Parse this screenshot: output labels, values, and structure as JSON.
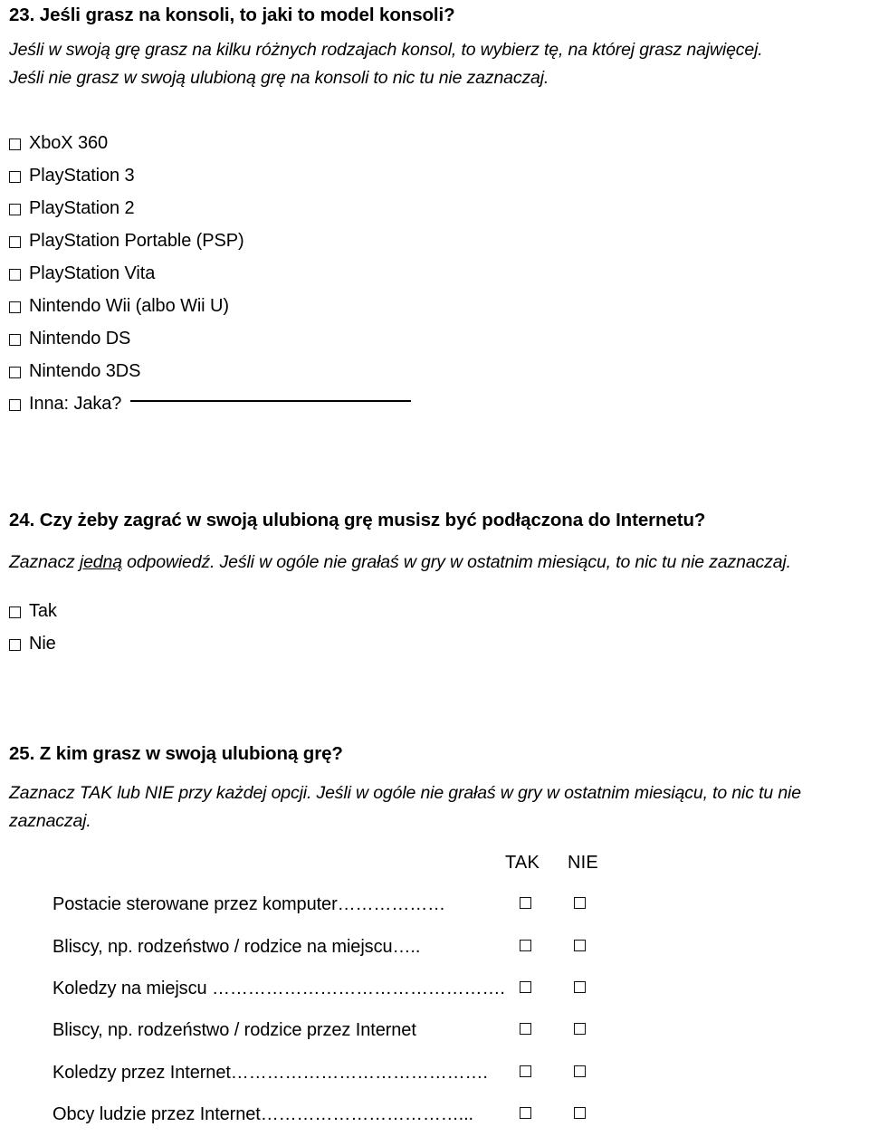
{
  "document": {
    "language": "pl",
    "background_color": "#ffffff",
    "text_color": "#000000"
  },
  "q23": {
    "heading": "23. Jeśli grasz na konsoli, to jaki to model konsoli?",
    "instruction_line1": "Jeśli w swoją grę grasz na kilku różnych rodzajach konsol, to wybierz tę, na której grasz najwięcej.",
    "instruction_line2": "Jeśli nie grasz w swoją ulubioną grę na konsoli to nic tu nie zaznaczaj.",
    "options": [
      {
        "label": "XboX 360"
      },
      {
        "label": "PlayStation 3"
      },
      {
        "label": "PlayStation 2"
      },
      {
        "label": "PlayStation Portable (PSP)"
      },
      {
        "label": "PlayStation Vita"
      },
      {
        "label": "Nintendo Wii (albo Wii U)"
      },
      {
        "label": "Nintendo DS"
      },
      {
        "label": "Nintendo 3DS"
      },
      {
        "label": "Inna: Jaka?",
        "has_write_in_line": true
      }
    ]
  },
  "q24": {
    "heading": "24. Czy żeby zagrać w swoją ulubioną grę musisz być podłączona do Internetu?",
    "instruction_prefix": "Zaznacz ",
    "instruction_underlined": "jedną",
    "instruction_suffix": " odpowiedź. Jeśli w ogóle nie grałaś w gry w ostatnim miesiącu, to nic tu nie zaznaczaj.",
    "options": [
      {
        "label": "Tak"
      },
      {
        "label": "Nie"
      }
    ]
  },
  "q25": {
    "heading": "25. Z kim grasz w swoją ulubioną grę?",
    "instruction_line1": "Zaznacz TAK lub NIE przy każdej opcji. Jeśli w ogóle nie grałaś w gry w ostatnim miesiącu, to nic tu nie",
    "instruction_line2": "zaznaczaj.",
    "columns": [
      "TAK",
      "NIE"
    ],
    "rows": [
      {
        "label": "Postacie sterowane przez komputer………………"
      },
      {
        "label": "Bliscy, np. rodzeństwo / rodzice na miejscu….."
      },
      {
        "label": "Koledzy na miejscu …………………………………………."
      },
      {
        "label": "Bliscy, np. rodzeństwo / rodzice przez Internet"
      },
      {
        "label": "Koledzy przez Internet……………………………………."
      },
      {
        "label": "Obcy ludzie przez Internet……………………………..."
      }
    ]
  }
}
